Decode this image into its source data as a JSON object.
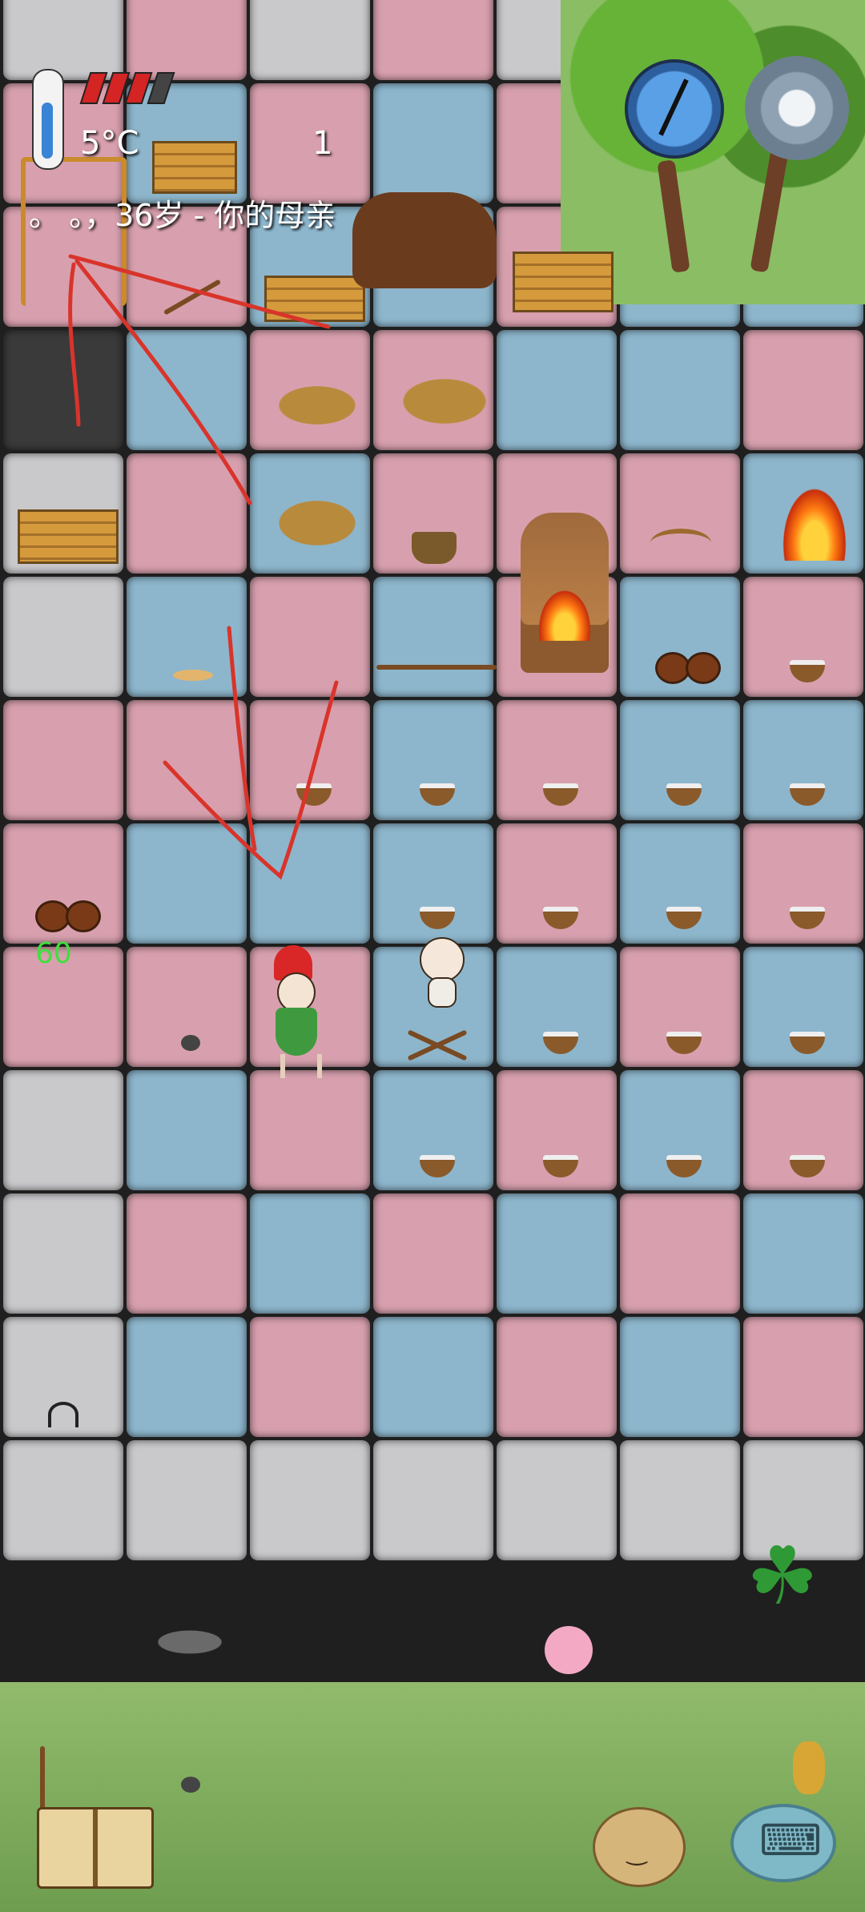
{
  "hud": {
    "temperature": "5°C",
    "counter": "1",
    "relation": "。 。，36岁 - 你的母亲",
    "food_pips_full": 3,
    "food_pips_total": 4,
    "yum_bonus": "60"
  },
  "icons": {
    "thermometer": "thermometer-icon",
    "compass": "compass-icon",
    "settings": "gear-icon",
    "recipe_book": "book-icon",
    "emote": "potato-face-icon",
    "keyboard": "keyboard-icon",
    "clover": "four-leaf-clover-icon"
  },
  "colors": {
    "pink_floor": "#d8a0ae",
    "blue_floor": "#8db6cc",
    "stone_floor": "#c9c9cc",
    "grass": "#86b463",
    "food_pip": "#d42424",
    "yum_text": "#3ee03e",
    "annotation_stroke": "#d9342b"
  },
  "clover_glyph": "☘"
}
